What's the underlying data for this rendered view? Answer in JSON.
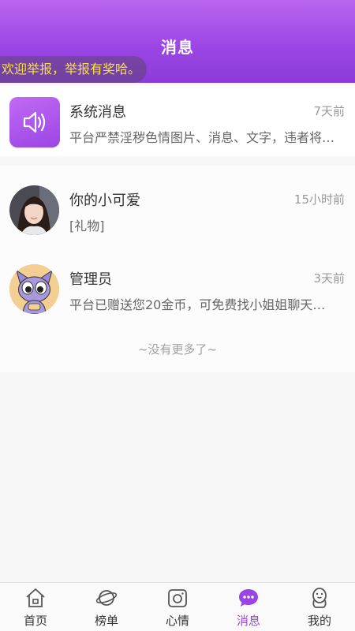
{
  "header": {
    "title": "消息",
    "marquee": "欢迎举报，举报有奖哈。"
  },
  "system_message": {
    "title": "系统消息",
    "time": "7天前",
    "preview": "平台严禁淫秽色情图片、消息、文字，违者将…",
    "icon": "speaker-icon"
  },
  "conversations": [
    {
      "name": "你的小可爱",
      "time": "15小时前",
      "preview": "[礼物]"
    },
    {
      "name": "管理员",
      "time": "3天前",
      "preview": "平台已赠送您20金币，可免费找小姐姐聊天…"
    }
  ],
  "end_text": "~没有更多了~",
  "tabbar": {
    "items": [
      {
        "label": "首页",
        "icon": "home-icon"
      },
      {
        "label": "榜单",
        "icon": "planet-icon"
      },
      {
        "label": "心情",
        "icon": "camera-icon"
      },
      {
        "label": "消息",
        "icon": "chat-bubble-icon"
      },
      {
        "label": "我的",
        "icon": "penguin-icon"
      }
    ],
    "active_index": 3
  },
  "colors": {
    "brand": "#9a45e3",
    "marquee_text": "#f6e33a"
  }
}
